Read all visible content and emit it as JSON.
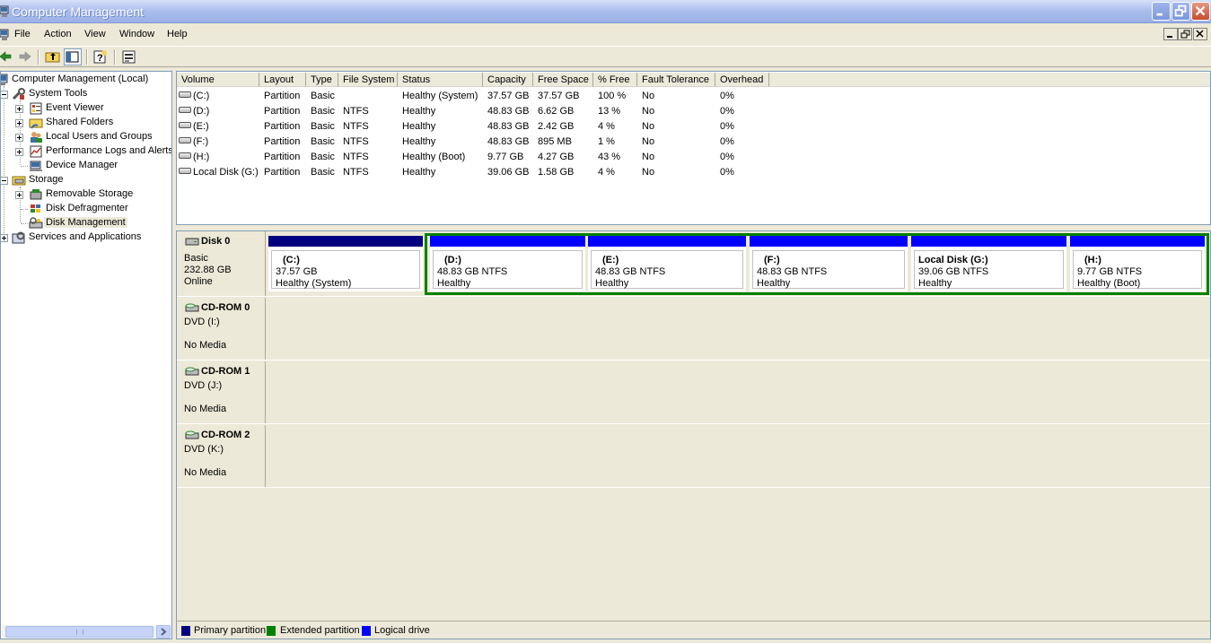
{
  "window": {
    "title": "Computer Management"
  },
  "menu": [
    "File",
    "Action",
    "View",
    "Window",
    "Help"
  ],
  "tree": {
    "root": "Computer Management (Local)",
    "system_tools": "System Tools",
    "event_viewer": "Event Viewer",
    "shared_folders": "Shared Folders",
    "local_users": "Local Users and Groups",
    "perf_logs": "Performance Logs and Alerts",
    "device_manager": "Device Manager",
    "storage": "Storage",
    "removable_storage": "Removable Storage",
    "disk_defrag": "Disk Defragmenter",
    "disk_management": "Disk Management",
    "services_apps": "Services and Applications"
  },
  "columns": [
    "Volume",
    "Layout",
    "Type",
    "File System",
    "Status",
    "Capacity",
    "Free Space",
    "% Free",
    "Fault Tolerance",
    "Overhead"
  ],
  "volumes": [
    [
      "(C:)",
      "Partition",
      "Basic",
      "",
      "Healthy (System)",
      "37.57 GB",
      "37.57 GB",
      "100 %",
      "No",
      "0%"
    ],
    [
      "(D:)",
      "Partition",
      "Basic",
      "NTFS",
      "Healthy",
      "48.83 GB",
      "6.62 GB",
      "13 %",
      "No",
      "0%"
    ],
    [
      "(E:)",
      "Partition",
      "Basic",
      "NTFS",
      "Healthy",
      "48.83 GB",
      "2.42 GB",
      "4 %",
      "No",
      "0%"
    ],
    [
      "(F:)",
      "Partition",
      "Basic",
      "NTFS",
      "Healthy",
      "48.83 GB",
      "895 MB",
      "1 %",
      "No",
      "0%"
    ],
    [
      "(H:)",
      "Partition",
      "Basic",
      "NTFS",
      "Healthy (Boot)",
      "9.77 GB",
      "4.27 GB",
      "43 %",
      "No",
      "0%"
    ],
    [
      "Local Disk (G:)",
      "Partition",
      "Basic",
      "NTFS",
      "Healthy",
      "39.06 GB",
      "1.58 GB",
      "4 %",
      "No",
      "0%"
    ]
  ],
  "disks": [
    {
      "name": "Disk 0",
      "l1": "Basic",
      "l2": "232.88 GB",
      "l3": "Online"
    },
    {
      "name": "CD-ROM 0",
      "l1": "DVD (I:)",
      "l2": "",
      "l3": "No Media"
    },
    {
      "name": "CD-ROM 1",
      "l1": "DVD (J:)",
      "l2": "",
      "l3": "No Media"
    },
    {
      "name": "CD-ROM 2",
      "l1": "DVD (K:)",
      "l2": "",
      "l3": "No Media"
    }
  ],
  "partitions": [
    {
      "name": "(C:)",
      "size": "37.57 GB",
      "status": "Healthy (System)",
      "kind": "primary"
    },
    {
      "name": "(D:)",
      "size": "48.83 GB NTFS",
      "status": "Healthy",
      "kind": "logical"
    },
    {
      "name": "(E:)",
      "size": "48.83 GB NTFS",
      "status": "Healthy",
      "kind": "logical"
    },
    {
      "name": "(F:)",
      "size": "48.83 GB NTFS",
      "status": "Healthy",
      "kind": "logical"
    },
    {
      "name": "Local Disk  (G:)",
      "size": "39.06 GB NTFS",
      "status": "Healthy",
      "kind": "logical"
    },
    {
      "name": "(H:)",
      "size": "9.77 GB NTFS",
      "status": "Healthy (Boot)",
      "kind": "logical"
    }
  ],
  "legend": {
    "primary": "Primary partition",
    "extended": "Extended partition",
    "logical": "Logical drive"
  },
  "colors": {
    "primary": "#000080",
    "extended": "#008000",
    "logical": "#0000ff"
  },
  "icons": {
    "title": "computer-icon",
    "back": "back-arrow-icon",
    "forward": "forward-arrow-icon",
    "up": "up-folder-icon",
    "tree_toggle": "show-hide-tree-icon",
    "help": "help-icon",
    "properties": "properties-icon"
  }
}
